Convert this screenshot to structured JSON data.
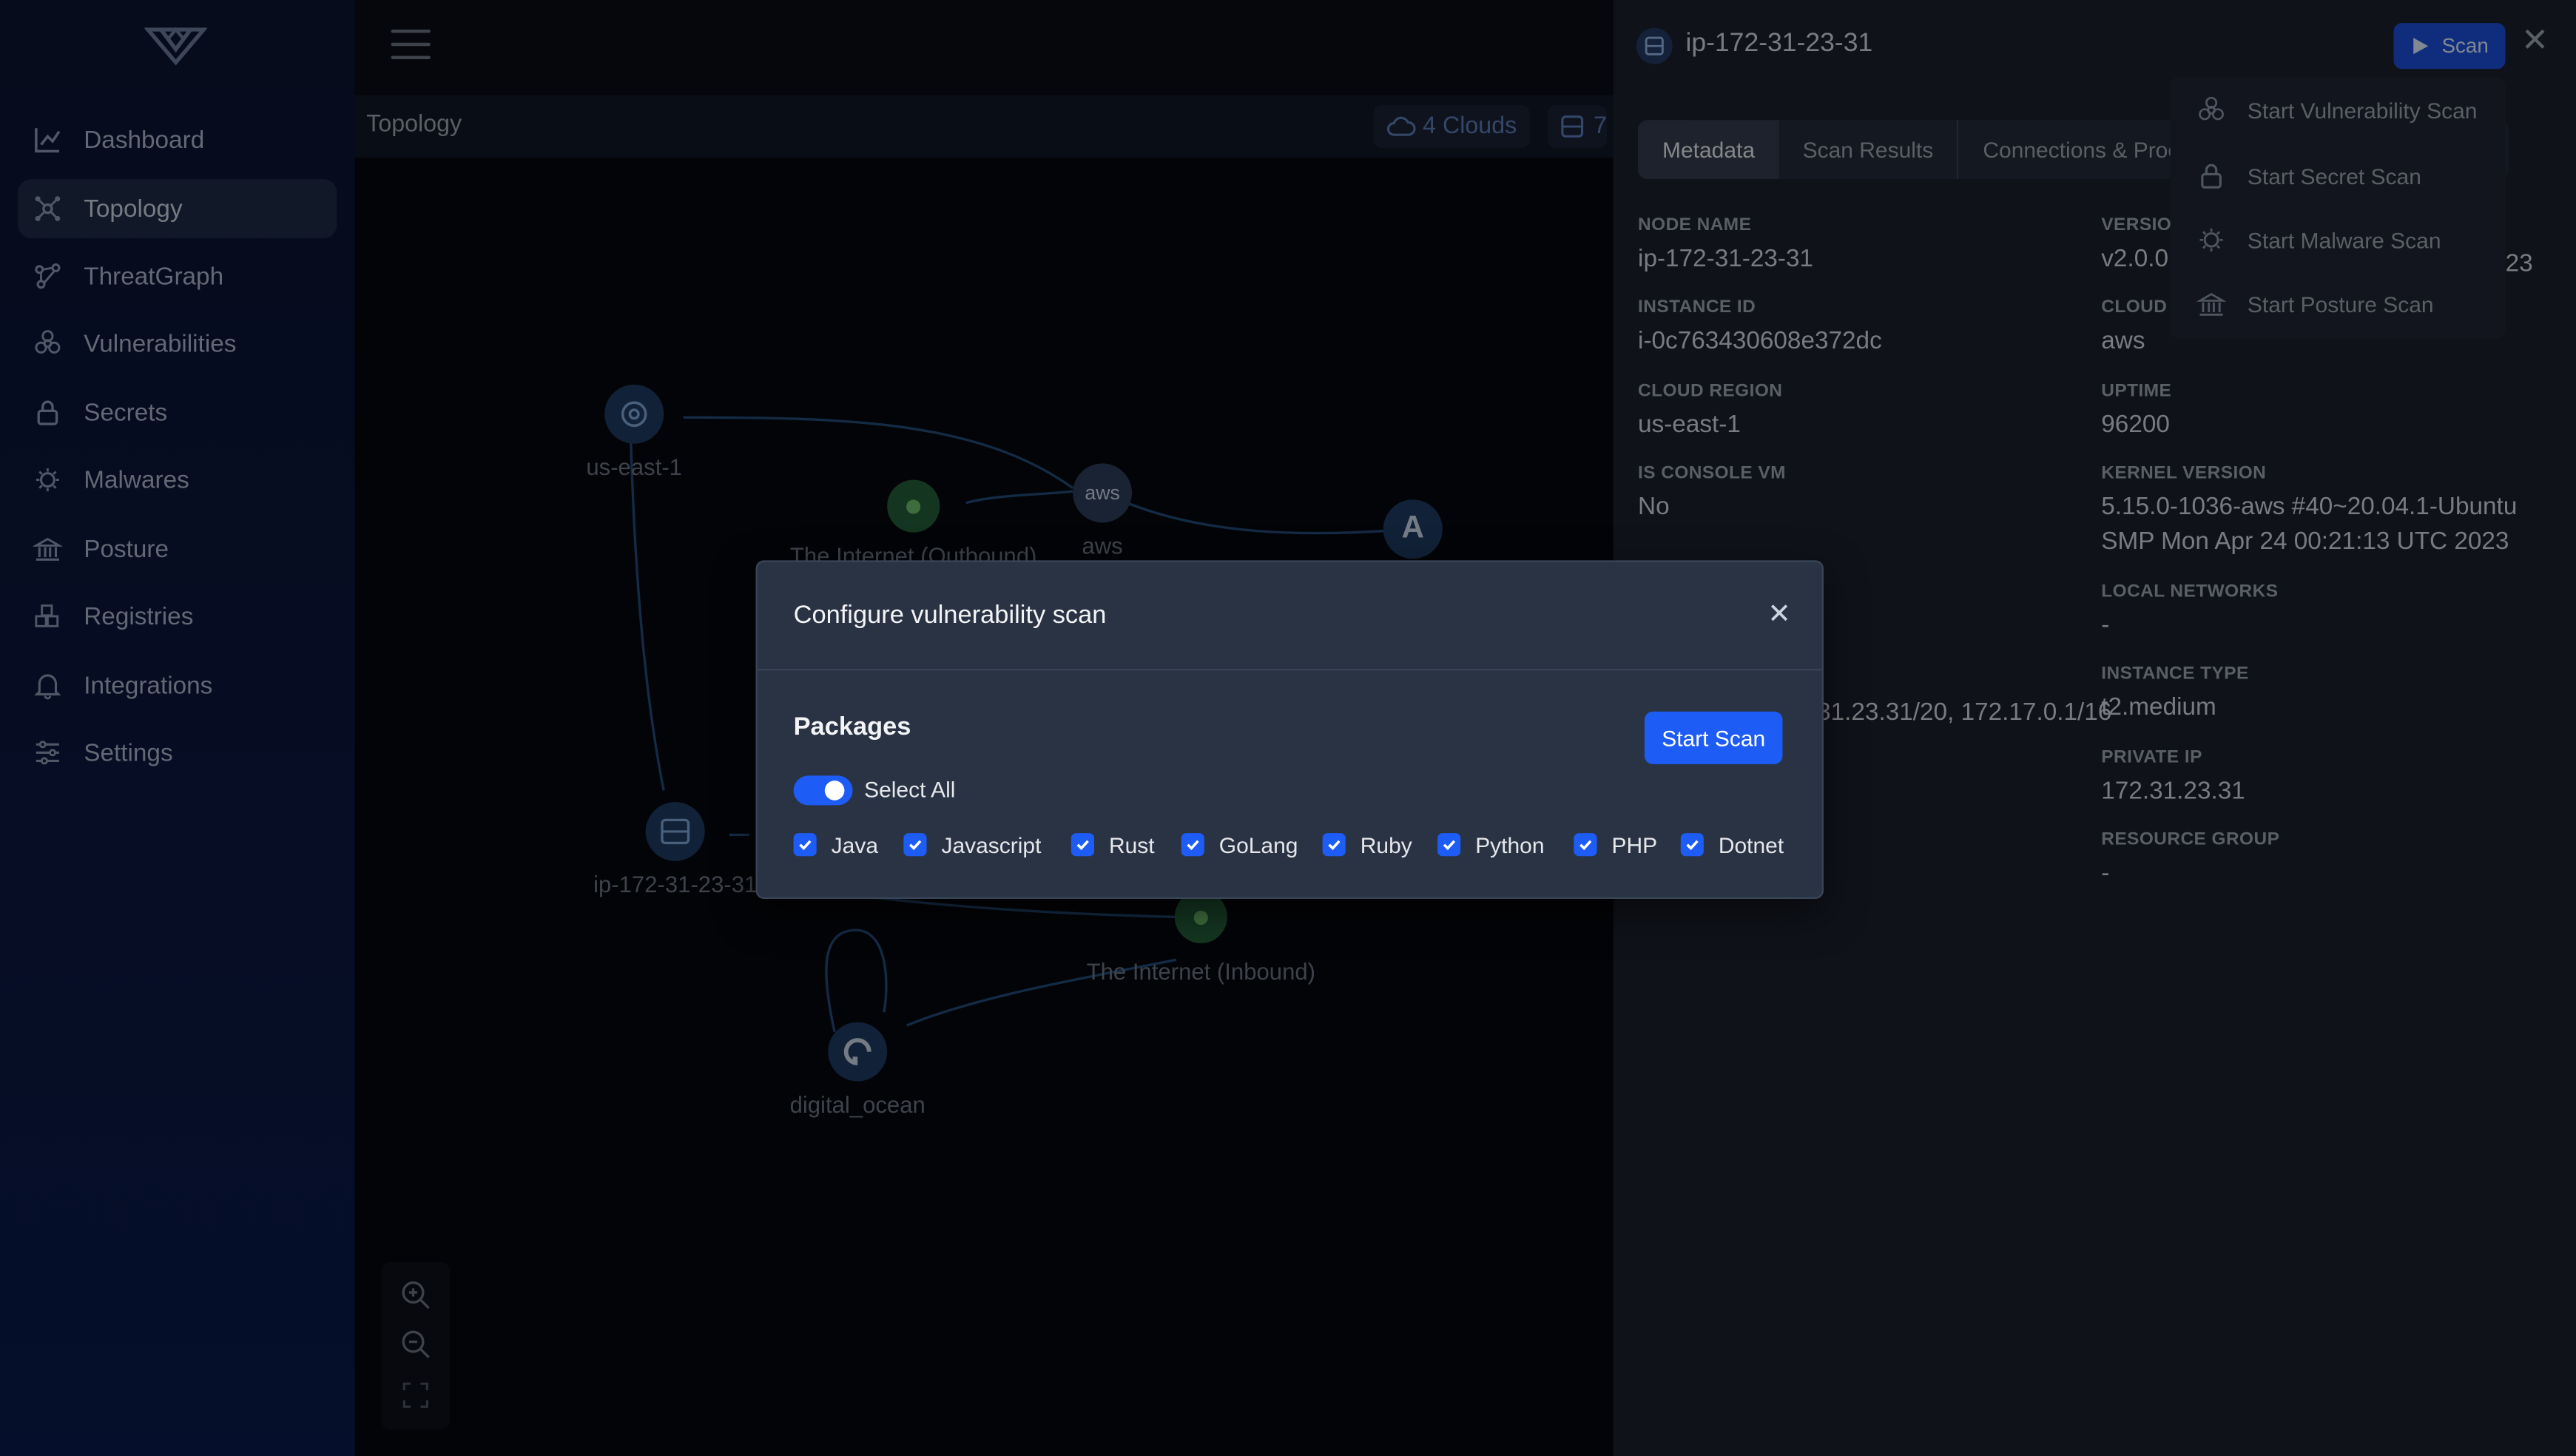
{
  "sidebar": {
    "items": [
      {
        "label": "Dashboard",
        "icon": "chart-line-icon"
      },
      {
        "label": "Topology",
        "icon": "topology-icon",
        "active": true
      },
      {
        "label": "ThreatGraph",
        "icon": "threatgraph-icon"
      },
      {
        "label": "Vulnerabilities",
        "icon": "biohazard-icon"
      },
      {
        "label": "Secrets",
        "icon": "lock-icon"
      },
      {
        "label": "Malwares",
        "icon": "bug-icon"
      },
      {
        "label": "Posture",
        "icon": "bank-icon"
      },
      {
        "label": "Registries",
        "icon": "boxes-icon"
      },
      {
        "label": "Integrations",
        "icon": "bell-icon"
      },
      {
        "label": "Settings",
        "icon": "sliders-icon"
      }
    ]
  },
  "topology": {
    "title": "Topology",
    "clouds_pill": "4 Clouds",
    "hosts_pill": "7",
    "nodes": {
      "region": "us-east-1",
      "aws": "aws",
      "internet_out": "The Internet (Outbound)",
      "host": "ip-172-31-23-31",
      "internet_in": "The Internet (Inbound)",
      "digital_ocean": "digital_ocean"
    }
  },
  "panel": {
    "title": "ip-172-31-23-31",
    "scan_label": "Scan",
    "tabs": [
      "Metadata",
      "Scan Results",
      "Connections & Processes"
    ],
    "fields": {
      "node_name": {
        "k": "NODE NAME",
        "v": "ip-172-31-23-31"
      },
      "version": {
        "k": "VERSION",
        "v": "v2.0.0"
      },
      "version_tail": "23",
      "instance_id": {
        "k": "INSTANCE ID",
        "v": "i-0c763430608e372dc"
      },
      "cloud": {
        "k": "CLOUD P",
        "v": "aws"
      },
      "cloud_region": {
        "k": "CLOUD REGION",
        "v": "us-east-1"
      },
      "uptime": {
        "k": "UPTIME",
        "v": "96200"
      },
      "is_console_vm": {
        "k": "IS CONSOLE VM",
        "v": "No"
      },
      "kernel_version": {
        "k": "KERNEL VERSION",
        "v": "5.15.0-1036-aws #40~20.04.1-Ubuntu SMP Mon Apr 24 00:21:13 UTC 2023"
      },
      "local_networks": {
        "k": "LOCAL NETWORKS",
        "v": "-"
      },
      "interface_ips": "31.23.31/20, 172.17.0.1/16",
      "instance_type": {
        "k": "INSTANCE TYPE",
        "v": "t2.medium"
      },
      "private_ip": {
        "k": "PRIVATE IP",
        "v": "172.31.23.31"
      },
      "resource_group": {
        "k": "RESOURCE GROUP",
        "v": "-"
      }
    }
  },
  "scan_menu": {
    "items": [
      {
        "label": "Start Vulnerability Scan",
        "icon": "biohazard-icon"
      },
      {
        "label": "Start Secret Scan",
        "icon": "lock-icon"
      },
      {
        "label": "Start Malware Scan",
        "icon": "bug-icon"
      },
      {
        "label": "Start Posture Scan",
        "icon": "bank-icon"
      }
    ]
  },
  "modal": {
    "title": "Configure vulnerability scan",
    "packages_label": "Packages",
    "start_label": "Start Scan",
    "select_all_label": "Select All",
    "select_all_on": true,
    "packages": [
      "Java",
      "Javascript",
      "Rust",
      "GoLang",
      "Ruby",
      "Python",
      "PHP",
      "Dotnet"
    ]
  },
  "colors": {
    "accent": "#1d5cf5",
    "sidebar_bg": "#0c1530",
    "panel_bg": "#1a1f2b"
  }
}
